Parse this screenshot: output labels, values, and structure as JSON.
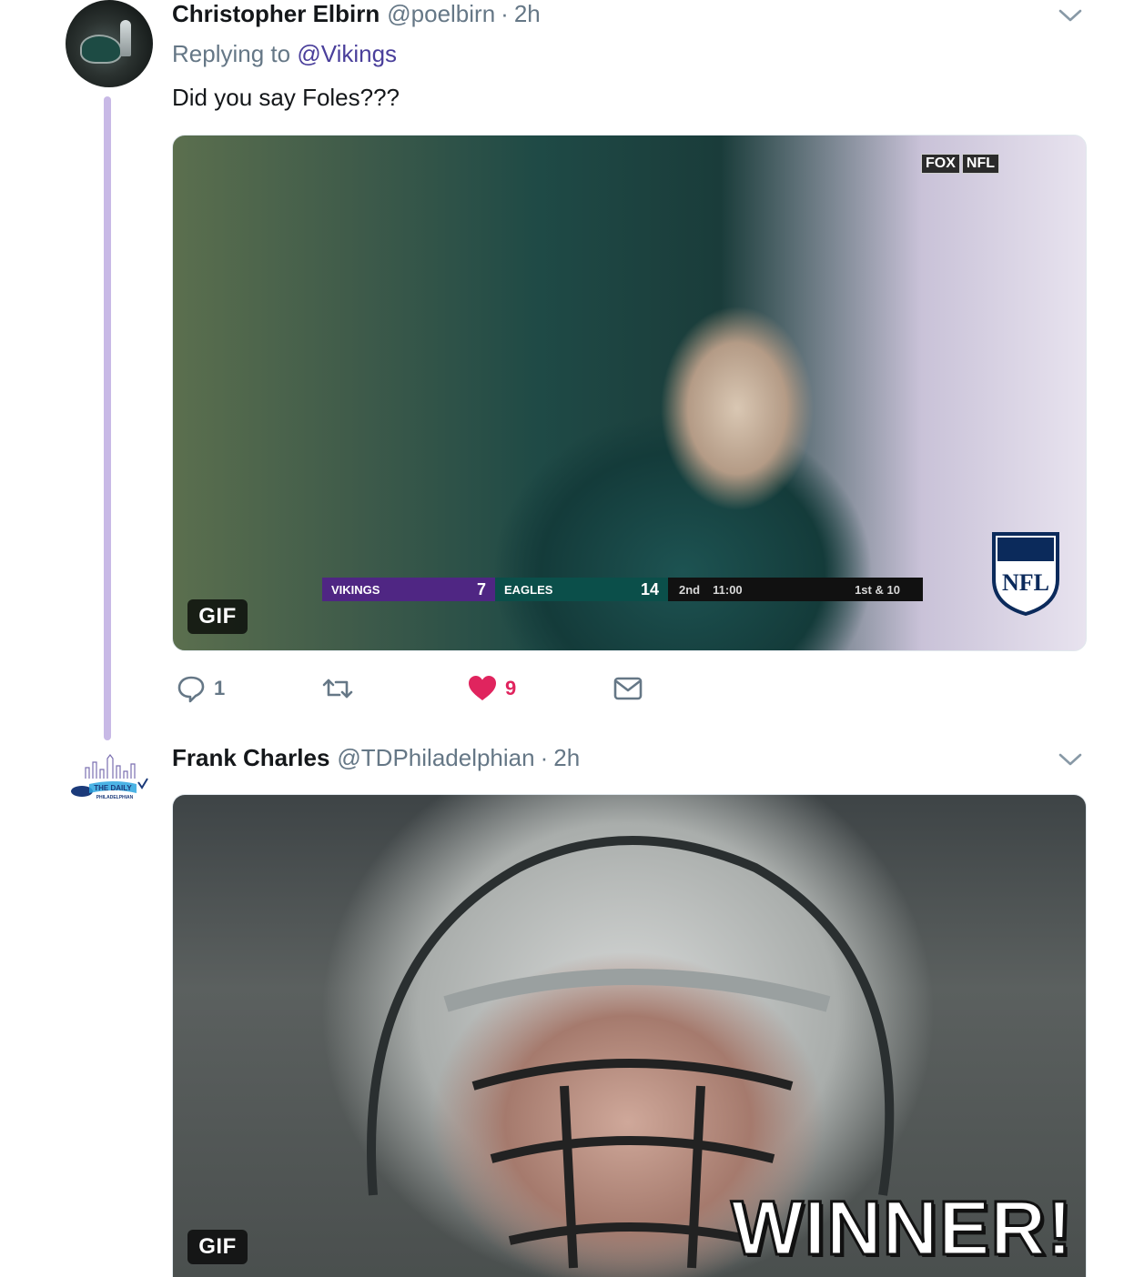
{
  "tweets": [
    {
      "name": "Christopher Elbirn",
      "handle": "@poelbirn",
      "separator": "·",
      "time": "2h",
      "replying_prefix": "Replying to",
      "replying_to": "@Vikings",
      "text": "Did you say Foles???",
      "media": {
        "badge": "GIF",
        "network_logo": [
          "FOX",
          "NFL"
        ],
        "scoreboard": {
          "team1": "VIKINGS",
          "score1": "7",
          "team2": "EAGLES",
          "score2": "14",
          "quarter": "2nd",
          "clock": "11:00",
          "down": "1st & 10"
        },
        "shield_label": "NFL"
      },
      "actions": {
        "reply_count": "1",
        "retweet_count": "",
        "like_count": "9"
      }
    },
    {
      "name": "Frank Charles",
      "handle": "@TDPhiladelphian",
      "separator": "·",
      "time": "2h",
      "avatar_logo_text": [
        "THE DAILY",
        "PHILADELPHIAN"
      ],
      "media": {
        "badge": "GIF",
        "caption": "WINNER!"
      }
    }
  ],
  "colors": {
    "thread_line": "#c8b9e6",
    "mention": "#4a3f9b",
    "like": "#e0245e",
    "muted": "#657786"
  }
}
